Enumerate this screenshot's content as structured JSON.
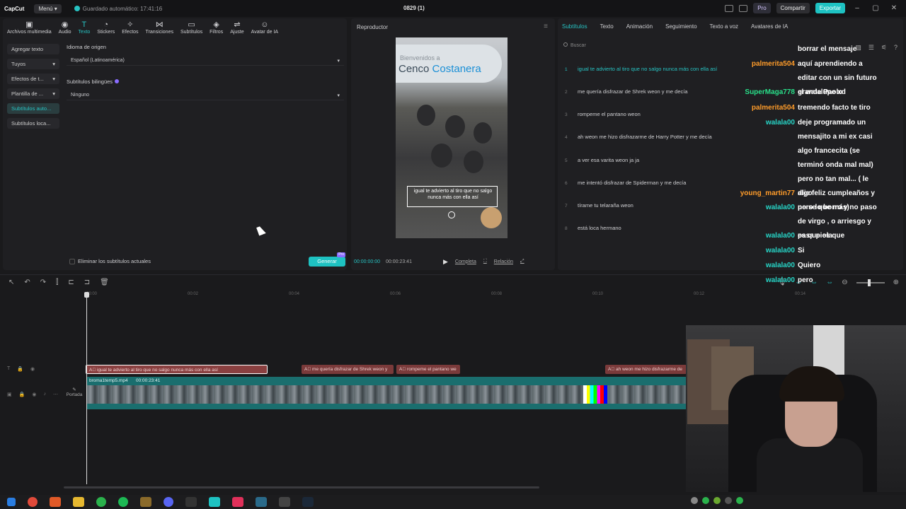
{
  "app": {
    "logo": "CapCut",
    "menu_label": "Menú",
    "autosave": "Guardado automático: 17:41:16",
    "project_title": "0829 (1)",
    "pro_label": "Pro",
    "share_label": "Compartir",
    "export_label": "Exportar",
    "accent_color": "#1ec2c2"
  },
  "toolbar": {
    "items": [
      {
        "label": "Archivos multimedia",
        "icon": "media-icon"
      },
      {
        "label": "Audio",
        "icon": "audio-icon"
      },
      {
        "label": "Texto",
        "icon": "text-icon"
      },
      {
        "label": "Stickers",
        "icon": "sticker-icon"
      },
      {
        "label": "Efectos",
        "icon": "effects-icon"
      },
      {
        "label": "Transiciones",
        "icon": "transitions-icon"
      },
      {
        "label": "Subtítulos",
        "icon": "subtitles-icon"
      },
      {
        "label": "Filtros",
        "icon": "filters-icon"
      },
      {
        "label": "Ajuste",
        "icon": "adjust-icon"
      },
      {
        "label": "Avatar de IA",
        "icon": "avatar-icon"
      }
    ]
  },
  "subnav": {
    "items": [
      {
        "label": "Agregar texto"
      },
      {
        "label": "Tuyos"
      },
      {
        "label": "Efectos de t..."
      },
      {
        "label": "Plantilla de ..."
      },
      {
        "label": "Subtítulos auto..."
      },
      {
        "label": "Subtítulos loca..."
      }
    ]
  },
  "form": {
    "lang_label": "Idioma de origen",
    "lang_value": "Español (Latinoamérica)",
    "bilingual_label": "Subtítulos bilingües",
    "bilingual_value": "Ninguno",
    "remove_label": "Eliminar los subtítulos actuales",
    "generate_label": "Generar",
    "generate_badge": "Pro"
  },
  "player": {
    "title": "Reproductor",
    "sign_line1": "Bienvenidos a",
    "sign_line2a": "Cenco",
    "sign_line2b": "Costanera",
    "caption": "igual te advierto al tiro que no salgo nunca más con ella así",
    "time_current": "00:00:00:00",
    "time_total": "00:00:23:41",
    "full_label": "Completa",
    "ratio_label": "Relación"
  },
  "subs": {
    "tabs": [
      "Subtítulos",
      "Texto",
      "Animación",
      "Seguimiento",
      "Texto a voz",
      "Avatares de IA"
    ],
    "search_placeholder": "Buscar",
    "rows": [
      {
        "num": "1",
        "text": "igual te advierto al tiro que no salgo nunca más con ella así"
      },
      {
        "num": "2",
        "text": "me quería disfrazar de Shrek weon y me decía"
      },
      {
        "num": "3",
        "text": "rompeme el pantano weon"
      },
      {
        "num": "4",
        "text": "ah weon me hizo disfrazarme de Harry Potter y me decía"
      },
      {
        "num": "5",
        "text": "a ver esa varita weon ja ja"
      },
      {
        "num": "6",
        "text": "me intentó disfrazar de Spiderman y me decía"
      },
      {
        "num": "7",
        "text": "tírame tu telaraña weon"
      },
      {
        "num": "8",
        "text": "está loca hermano"
      }
    ]
  },
  "chat": {
    "lines": [
      {
        "user": "",
        "msg": "borrar el mensaje"
      },
      {
        "user": "palmerita504",
        "msg": "aquí aprendiendo a editar con un sin futuro grande Paolo"
      },
      {
        "user": "SuperMaga778",
        "msg": "el walalupe xd"
      },
      {
        "user": "palmerita504",
        "msg": "tremendo facto te tiro"
      },
      {
        "user": "walala00",
        "msg": "deje programado un mensajito a mi ex casi algo francecita (se terminó onda mal mal) pero no tan mal... ( le dije feliz cumpleaños y no se que más)"
      },
      {
        "user": "young_martin77",
        "msg": "algo"
      },
      {
        "user": "walala00",
        "msg": "pero lo borro y no paso de virgo , o arriesgo y pasa piola"
      },
      {
        "user": "walala00",
        "msg": "es que es que"
      },
      {
        "user": "walala00",
        "msg": "Si"
      },
      {
        "user": "walala00",
        "msg": "Quiero"
      },
      {
        "user": "walala00",
        "msg": "pero"
      }
    ]
  },
  "timeline": {
    "ruler": [
      "00:00",
      "00:02",
      "00:04",
      "00:06",
      "00:08",
      "00:10",
      "00:12",
      "00:14"
    ],
    "text_clips": [
      {
        "label": "igual te advierto al tiro que no salgo nunca más con ella así"
      },
      {
        "label": "me quería disfrazar de Shrek weon y"
      },
      {
        "label": "rompeme el pantano we"
      },
      {
        "label": "ah weon me hizo disfrazarme de"
      }
    ],
    "video_name": "broma1temp5.mp4",
    "video_duration": "00:00:23:41",
    "cover_label": "Portada"
  }
}
